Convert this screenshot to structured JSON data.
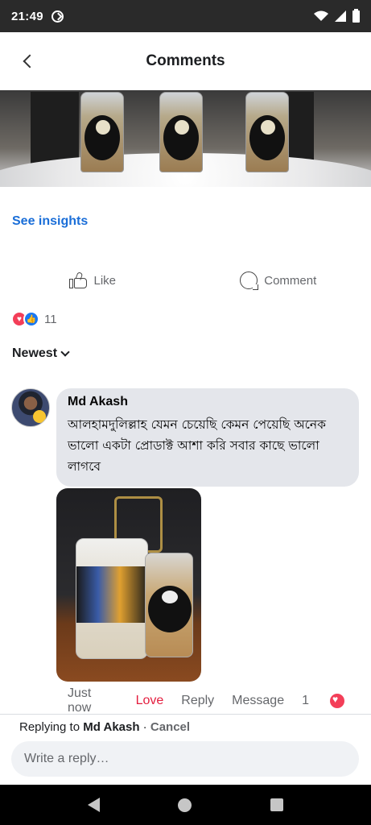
{
  "status_bar": {
    "time": "21:49"
  },
  "header": {
    "title": "Comments"
  },
  "post": {
    "insights_label": "See insights"
  },
  "actions": {
    "like_label": "Like",
    "comment_label": "Comment"
  },
  "reactions": {
    "count": "11"
  },
  "sort": {
    "label": "Newest"
  },
  "comment": {
    "author": "Md Akash",
    "text": "আলহামদুলিল্লাহ যেমন চেয়েছি কেমন পেয়েছি অনেক ভালো একটা প্রোডাক্ট আশা করি সবার কাছে ভালো লাগবে",
    "time": "Just now",
    "reaction_label": "Love",
    "reply_label": "Reply",
    "message_label": "Message",
    "reaction_count": "1"
  },
  "reply_bar": {
    "prefix": "Replying to",
    "target": "Md Akash",
    "separator": " · ",
    "cancel_label": "Cancel",
    "placeholder": "Write a reply…"
  },
  "colors": {
    "accent": "#1a6ed8",
    "love": "#e41e3f",
    "like": "#1877f2"
  }
}
